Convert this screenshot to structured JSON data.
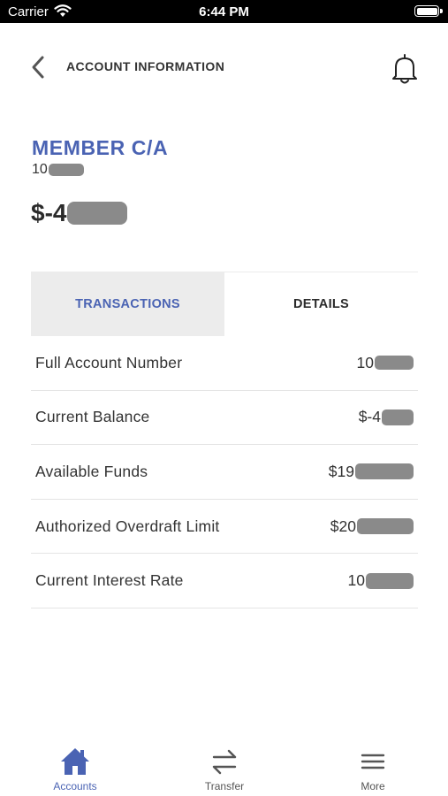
{
  "status_bar": {
    "carrier": "Carrier",
    "time": "6:44 PM",
    "icons": [
      "wifi-icon",
      "battery-icon"
    ]
  },
  "header": {
    "title": "ACCOUNT INFORMATION",
    "back_icon": "chevron-left-icon",
    "notification_icon": "bell-icon"
  },
  "account": {
    "name": "MEMBER C/A",
    "number_visible": "10",
    "balance_visible": "$-4"
  },
  "tabs": {
    "transactions": "TRANSACTIONS",
    "details": "DETAILS",
    "active": "transactions"
  },
  "details": [
    {
      "label": "Full Account Number",
      "value_visible": "10"
    },
    {
      "label": "Current Balance",
      "value_visible": "$-4"
    },
    {
      "label": "Available Funds",
      "value_visible": "$19"
    },
    {
      "label": "Authorized Overdraft Limit",
      "value_visible": "$20"
    },
    {
      "label": "Current Interest Rate",
      "value_visible": "10"
    }
  ],
  "tabbar": {
    "accounts": "Accounts",
    "transfer": "Transfer",
    "more": "More",
    "active": "accounts"
  },
  "colors": {
    "accent": "#4a63b3",
    "tab_inactive_bg": "#ececec",
    "redaction": "#8a8a8a"
  }
}
